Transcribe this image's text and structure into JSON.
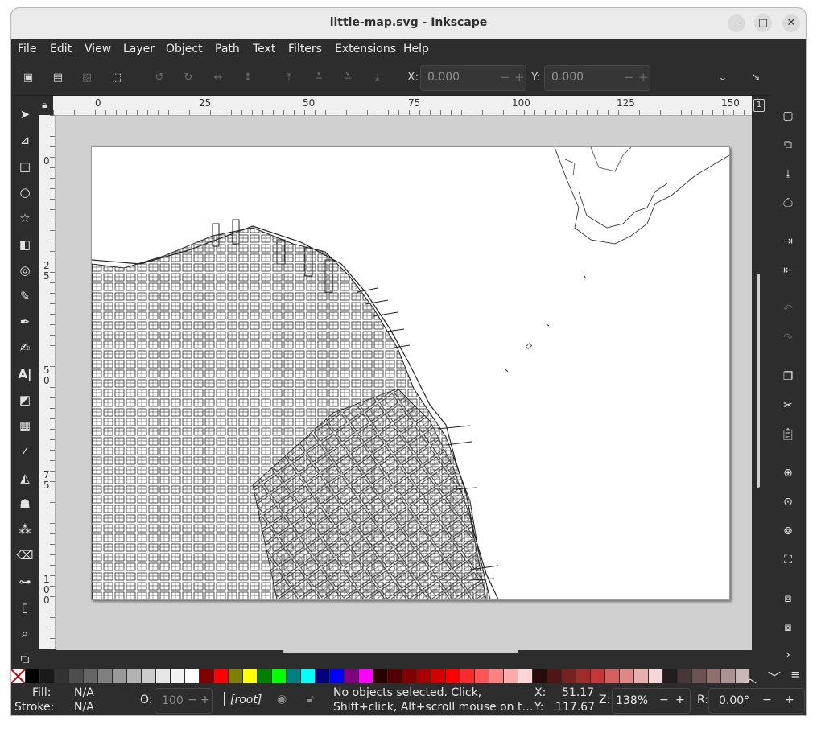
{
  "window": {
    "title": "little-map.svg - Inkscape"
  },
  "window_controls": {
    "minimize": "–",
    "maximize": "□",
    "close": "✕"
  },
  "menu": [
    "File",
    "Edit",
    "View",
    "Layer",
    "Object",
    "Path",
    "Text",
    "Filters",
    "Extensions",
    "Help"
  ],
  "toolbar": {
    "x_label": "X:",
    "x_value": "0.000",
    "y_label": "Y:",
    "y_value": "0.000",
    "minus": "−",
    "plus": "+"
  },
  "rulers": {
    "top": [
      "0",
      "25",
      "50",
      "75",
      "100",
      "125",
      "150"
    ],
    "left": [
      [
        "0"
      ],
      [
        "2",
        "5"
      ],
      [
        "5",
        "0"
      ],
      [
        "7",
        "5"
      ],
      [
        "1",
        "0",
        "0"
      ]
    ]
  },
  "palette": [
    "#000000",
    "#1a1a1a",
    "#333333",
    "#4d4d4d",
    "#666666",
    "#808080",
    "#999999",
    "#b3b3b3",
    "#cccccc",
    "#e6e6e6",
    "#f2f2f2",
    "#ffffff",
    "#800000",
    "#ff0000",
    "#808000",
    "#ffff00",
    "#008000",
    "#00ff00",
    "#008080",
    "#00ffff",
    "#000080",
    "#0000ff",
    "#800080",
    "#ff00ff",
    "#2b0000",
    "#550000",
    "#800000",
    "#aa0000",
    "#d40000",
    "#ff0000",
    "#ff2a2a",
    "#ff5555",
    "#ff8080",
    "#ffaaaa",
    "#ffd5d5",
    "#280b0b",
    "#501616",
    "#782121",
    "#a02c2c",
    "#c83737",
    "#d35f5f",
    "#de8787",
    "#e9afaf",
    "#f4d7d7",
    "#241c1c",
    "#483737",
    "#6c5353",
    "#916f6f",
    "#ac9393",
    "#c8b7b7"
  ],
  "status": {
    "fill_label": "Fill:",
    "fill_value": "N/A",
    "stroke_label": "Stroke:",
    "stroke_value": "N/A",
    "opacity_label": "O:",
    "opacity_value": "100",
    "layer": "[root]",
    "message_line1": "No objects selected. Click,",
    "message_line2": "Shift+click, Alt+scroll mouse on t…",
    "x_label": "X:",
    "x_value": "51.17",
    "y_label": "Y:",
    "y_value": "117.67",
    "zoom_label": "Z:",
    "zoom_value": "138%",
    "rotation_label": "R:",
    "rotation_value": "0.00°",
    "minus": "−",
    "plus": "+"
  }
}
